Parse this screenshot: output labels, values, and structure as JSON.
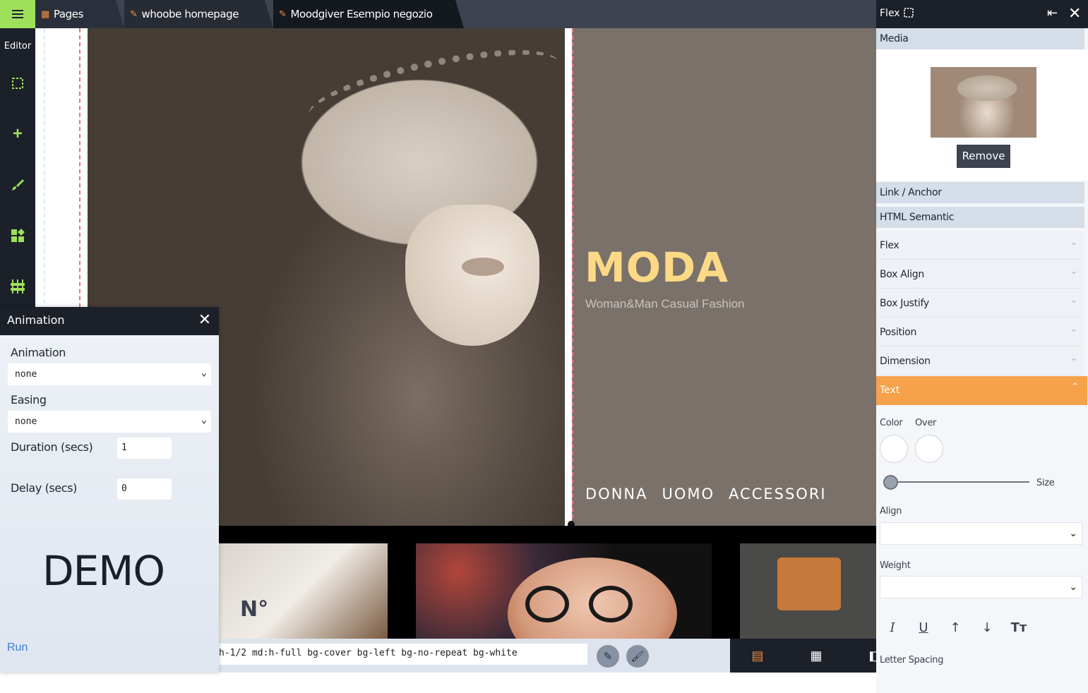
{
  "topbar": {
    "tabs": [
      {
        "label": "Pages"
      },
      {
        "label": "whoobe homepage"
      },
      {
        "label": "Moodgiver Esempio negozio"
      }
    ]
  },
  "rail": {
    "label": "Editor",
    "add_symbol": "+"
  },
  "hero": {
    "title": "MODA",
    "subtitle": "Woman&Man Casual Fashion",
    "nav": [
      "DONNA",
      "UOMO",
      "ACCESSORI"
    ]
  },
  "thumbs": {
    "shirt_text": "N°"
  },
  "classbar": {
    "value": "h-1/2 md:h-full bg-cover bg-left bg-no-repeat bg-white"
  },
  "animation_panel": {
    "title": "Animation",
    "close_symbol": "✕",
    "animation_label": "Animation",
    "animation_value": "none",
    "easing_label": "Easing",
    "easing_value": "none",
    "duration_label": "Duration (secs)",
    "duration_value": "1",
    "delay_label": "Delay (secs)",
    "delay_value": "0",
    "demo_text": "DEMO",
    "run_label": "Run"
  },
  "right_panel": {
    "title": "Flex",
    "close_symbol": "✕",
    "media_section": "Media",
    "remove_label": "Remove",
    "link_section": "Link / Anchor",
    "semantic_section": "HTML Semantic",
    "rows": [
      "Flex",
      "Box Align",
      "Box Justify",
      "Position",
      "Dimension"
    ],
    "text_section": "Text",
    "color_label": "Color",
    "over_label": "Over",
    "size_label": "Size",
    "size_value": 0,
    "align_label": "Align",
    "weight_label": "Weight",
    "letter_spacing_label": "Letter Spacing"
  },
  "colors": {
    "accent_green": "#9ee05a",
    "accent_orange": "#f5a24a",
    "moda_title": "#fbd985",
    "dark_bar": "#1b2029"
  },
  "icons": [
    "menu-icon",
    "pages-icon",
    "pencil-icon",
    "select-icon",
    "add-icon",
    "brush-icon",
    "blocks-icon",
    "tree-icon",
    "close-icon",
    "collapse-icon",
    "chevron-down-icon",
    "chevron-up-icon",
    "italic-icon",
    "underline-icon",
    "arrow-up-icon",
    "arrow-down-icon",
    "text-size-icon",
    "document-icon",
    "grid-icon",
    "code-icon",
    "edit-icon",
    "brush-icon"
  ]
}
